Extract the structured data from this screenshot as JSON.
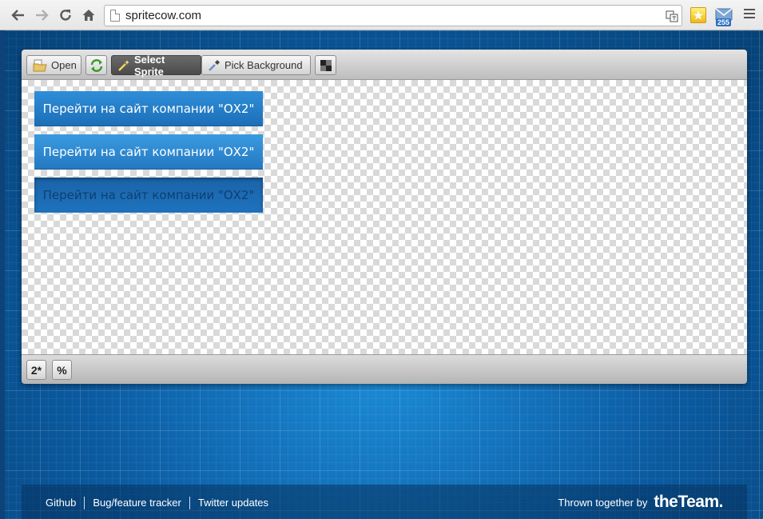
{
  "browser": {
    "url": "spritecow.com",
    "mail_count": "255"
  },
  "toolbar": {
    "open_label": "Open",
    "select_sprite_label": "Select Sprite",
    "pick_background_label": "Pick Background"
  },
  "sprites": [
    {
      "text": "Перейти на сайт компании \"ОХ2\""
    },
    {
      "text": "Перейти на сайт компании \"ОХ2\""
    },
    {
      "text": "Перейти на сайт компании \"ОХ2\""
    }
  ],
  "bottombar": {
    "retina_label": "2*",
    "percent_label": "%"
  },
  "footer": {
    "links": [
      "Github",
      "Bug/feature tracker",
      "Twitter updates"
    ],
    "credit_text": "Thrown together by",
    "brand": "theTeam."
  },
  "colors": {
    "sprite_blue": "#2479c2",
    "page_blue": "#0a5596"
  }
}
